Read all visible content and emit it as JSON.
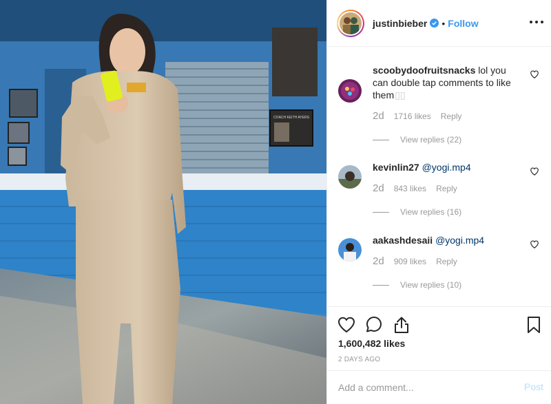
{
  "header": {
    "username": "justinbieber",
    "verified": true,
    "separator": "•",
    "follow_label": "Follow",
    "more_icon": "more-horizontal-icon"
  },
  "photo": {
    "description_icon": "post-photo",
    "sign_text": "COACH KEITH AYERS"
  },
  "comments": [
    {
      "username": "scoobydoofruitsnacks",
      "text": "lol you can double tap comments to like them",
      "trailing": " ▯▯",
      "age": "2d",
      "likes": "1716 likes",
      "reply_label": "Reply",
      "view_replies": "View replies (22)"
    },
    {
      "username": "kevinlin27",
      "mention": "@yogi.mp4",
      "age": "2d",
      "likes": "843 likes",
      "reply_label": "Reply",
      "view_replies": "View replies (16)"
    },
    {
      "username": "aakashdesaii",
      "mention": "@yogi.mp4",
      "age": "2d",
      "likes": "909 likes",
      "reply_label": "Reply",
      "view_replies": "View replies (10)"
    }
  ],
  "actions": {
    "like_icon": "heart-icon",
    "comment_icon": "comment-icon",
    "share_icon": "share-icon",
    "save_icon": "bookmark-icon",
    "likes_count": "1,600,482 likes",
    "date": "2 DAYS AGO"
  },
  "add_comment": {
    "placeholder": "Add a comment...",
    "post_label": "Post"
  },
  "colors": {
    "follow_blue": "#3897f0",
    "mention_blue": "#003569",
    "post_disabled": "#b2dffc",
    "muted_gray": "#999999",
    "divider": "#efefef"
  }
}
